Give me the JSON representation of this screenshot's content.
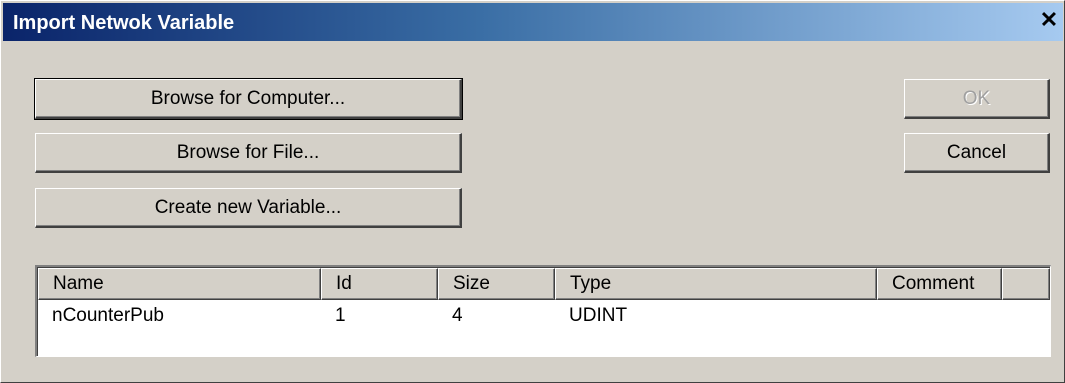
{
  "window": {
    "title": "Import Netwok Variable",
    "close_icon": "close-icon",
    "close_glyph": "✕"
  },
  "buttons": {
    "browse_computer": "Browse for Computer...",
    "browse_file": "Browse for File...",
    "create_variable": "Create new Variable...",
    "ok": "OK",
    "cancel": "Cancel"
  },
  "list": {
    "columns": [
      "Name",
      "Id",
      "Size",
      "Type",
      "Comment",
      ""
    ],
    "rows": [
      {
        "name": "nCounterPub",
        "id": "1",
        "size": "4",
        "type": "UDINT",
        "comment": ""
      }
    ]
  },
  "colors": {
    "title_gradient_start": "#0a246a",
    "title_gradient_end": "#a6caf0",
    "face": "#d4d0c8",
    "disabled_text": "#a0a0a0"
  }
}
